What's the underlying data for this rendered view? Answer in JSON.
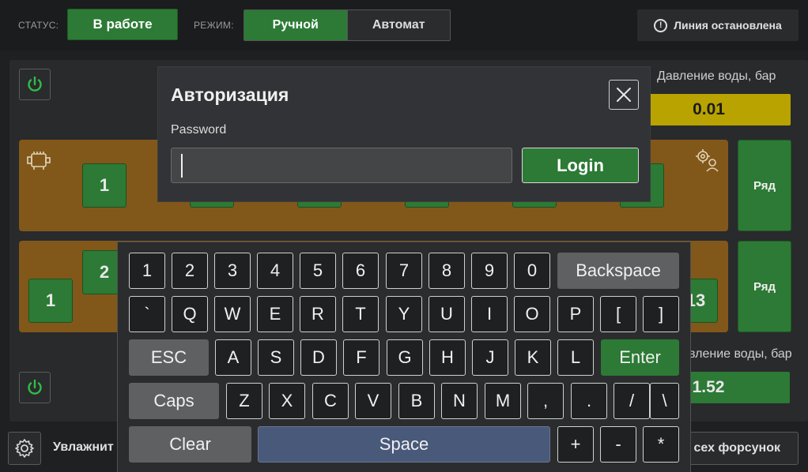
{
  "topbar": {
    "status_label": "СТАТУС:",
    "status_value": "В работе",
    "mode_label": "РЕЖИМ:",
    "mode_manual": "Ручной",
    "mode_auto": "Автомат",
    "line_status": "Линия остановлена",
    "line_status_icon": "!"
  },
  "section1": {
    "water_label": "Давление воды, бар",
    "water_value": "0.01",
    "row_button": "Ряд",
    "nozzles": [
      "1"
    ]
  },
  "section2": {
    "water_label": "вление воды, бар",
    "water_value": "1.52",
    "row_button": "Ряд",
    "nozzle_left": "1",
    "nozzle_top": "2",
    "nozzle_right": "13"
  },
  "bottombar": {
    "humidify_label": "Увлажнит",
    "all_nozzles_label": "сех форсунок"
  },
  "modal": {
    "title": "Авторизация",
    "password_label": "Password",
    "password_value": "",
    "login_label": "Login"
  },
  "keyboard": {
    "row1": [
      "1",
      "2",
      "3",
      "4",
      "5",
      "6",
      "7",
      "8",
      "9",
      "0"
    ],
    "backspace": "Backspace",
    "row2": [
      "`",
      "Q",
      "W",
      "E",
      "R",
      "T",
      "Y",
      "U",
      "I",
      "O",
      "P",
      "[",
      "]"
    ],
    "esc": "ESC",
    "row3": [
      "A",
      "S",
      "D",
      "F",
      "G",
      "H",
      "J",
      "K",
      "L"
    ],
    "enter": "Enter",
    "caps": "Caps",
    "row4": [
      "Z",
      "X",
      "C",
      "V",
      "B",
      "N",
      "M",
      ",",
      ".",
      "/",
      "\\"
    ],
    "clear": "Clear",
    "space": "Space",
    "plus": "+",
    "minus": "-",
    "star": "*"
  },
  "colors": {
    "accent_green": "#2c7a35",
    "row_band": "#82581a",
    "water_warn": "#b8a300",
    "space_key": "#48597a"
  }
}
